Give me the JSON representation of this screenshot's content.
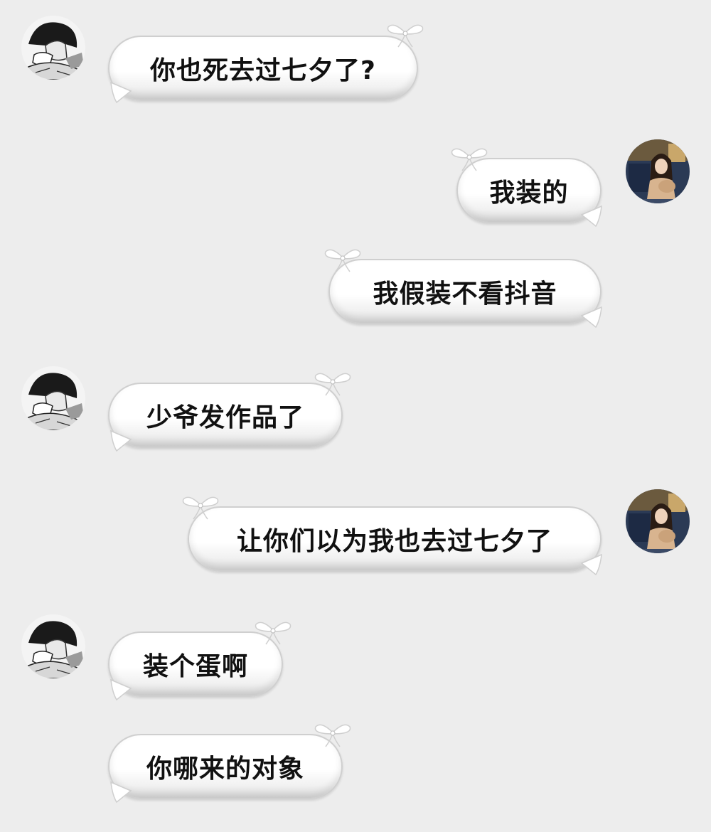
{
  "chat": {
    "messages": [
      {
        "side": "left",
        "text": "你也死去过七夕了?"
      },
      {
        "side": "right",
        "text": "我装的"
      },
      {
        "side": "right",
        "text": "我假装不看抖音"
      },
      {
        "side": "left",
        "text": "少爷发作品了"
      },
      {
        "side": "right",
        "text": "让你们以为我也去过七夕了"
      },
      {
        "side": "left",
        "text": "装个蛋啊"
      },
      {
        "side": "left",
        "text": "你哪来的对象"
      }
    ]
  },
  "avatars": {
    "left": {
      "icon": "manga-boy-avatar-icon"
    },
    "right": {
      "icon": "girl-photo-avatar-icon"
    }
  },
  "colors": {
    "background": "#ededed",
    "bubble": "#ffffff",
    "bubble_border": "#cfcfcf",
    "text": "#111111"
  }
}
